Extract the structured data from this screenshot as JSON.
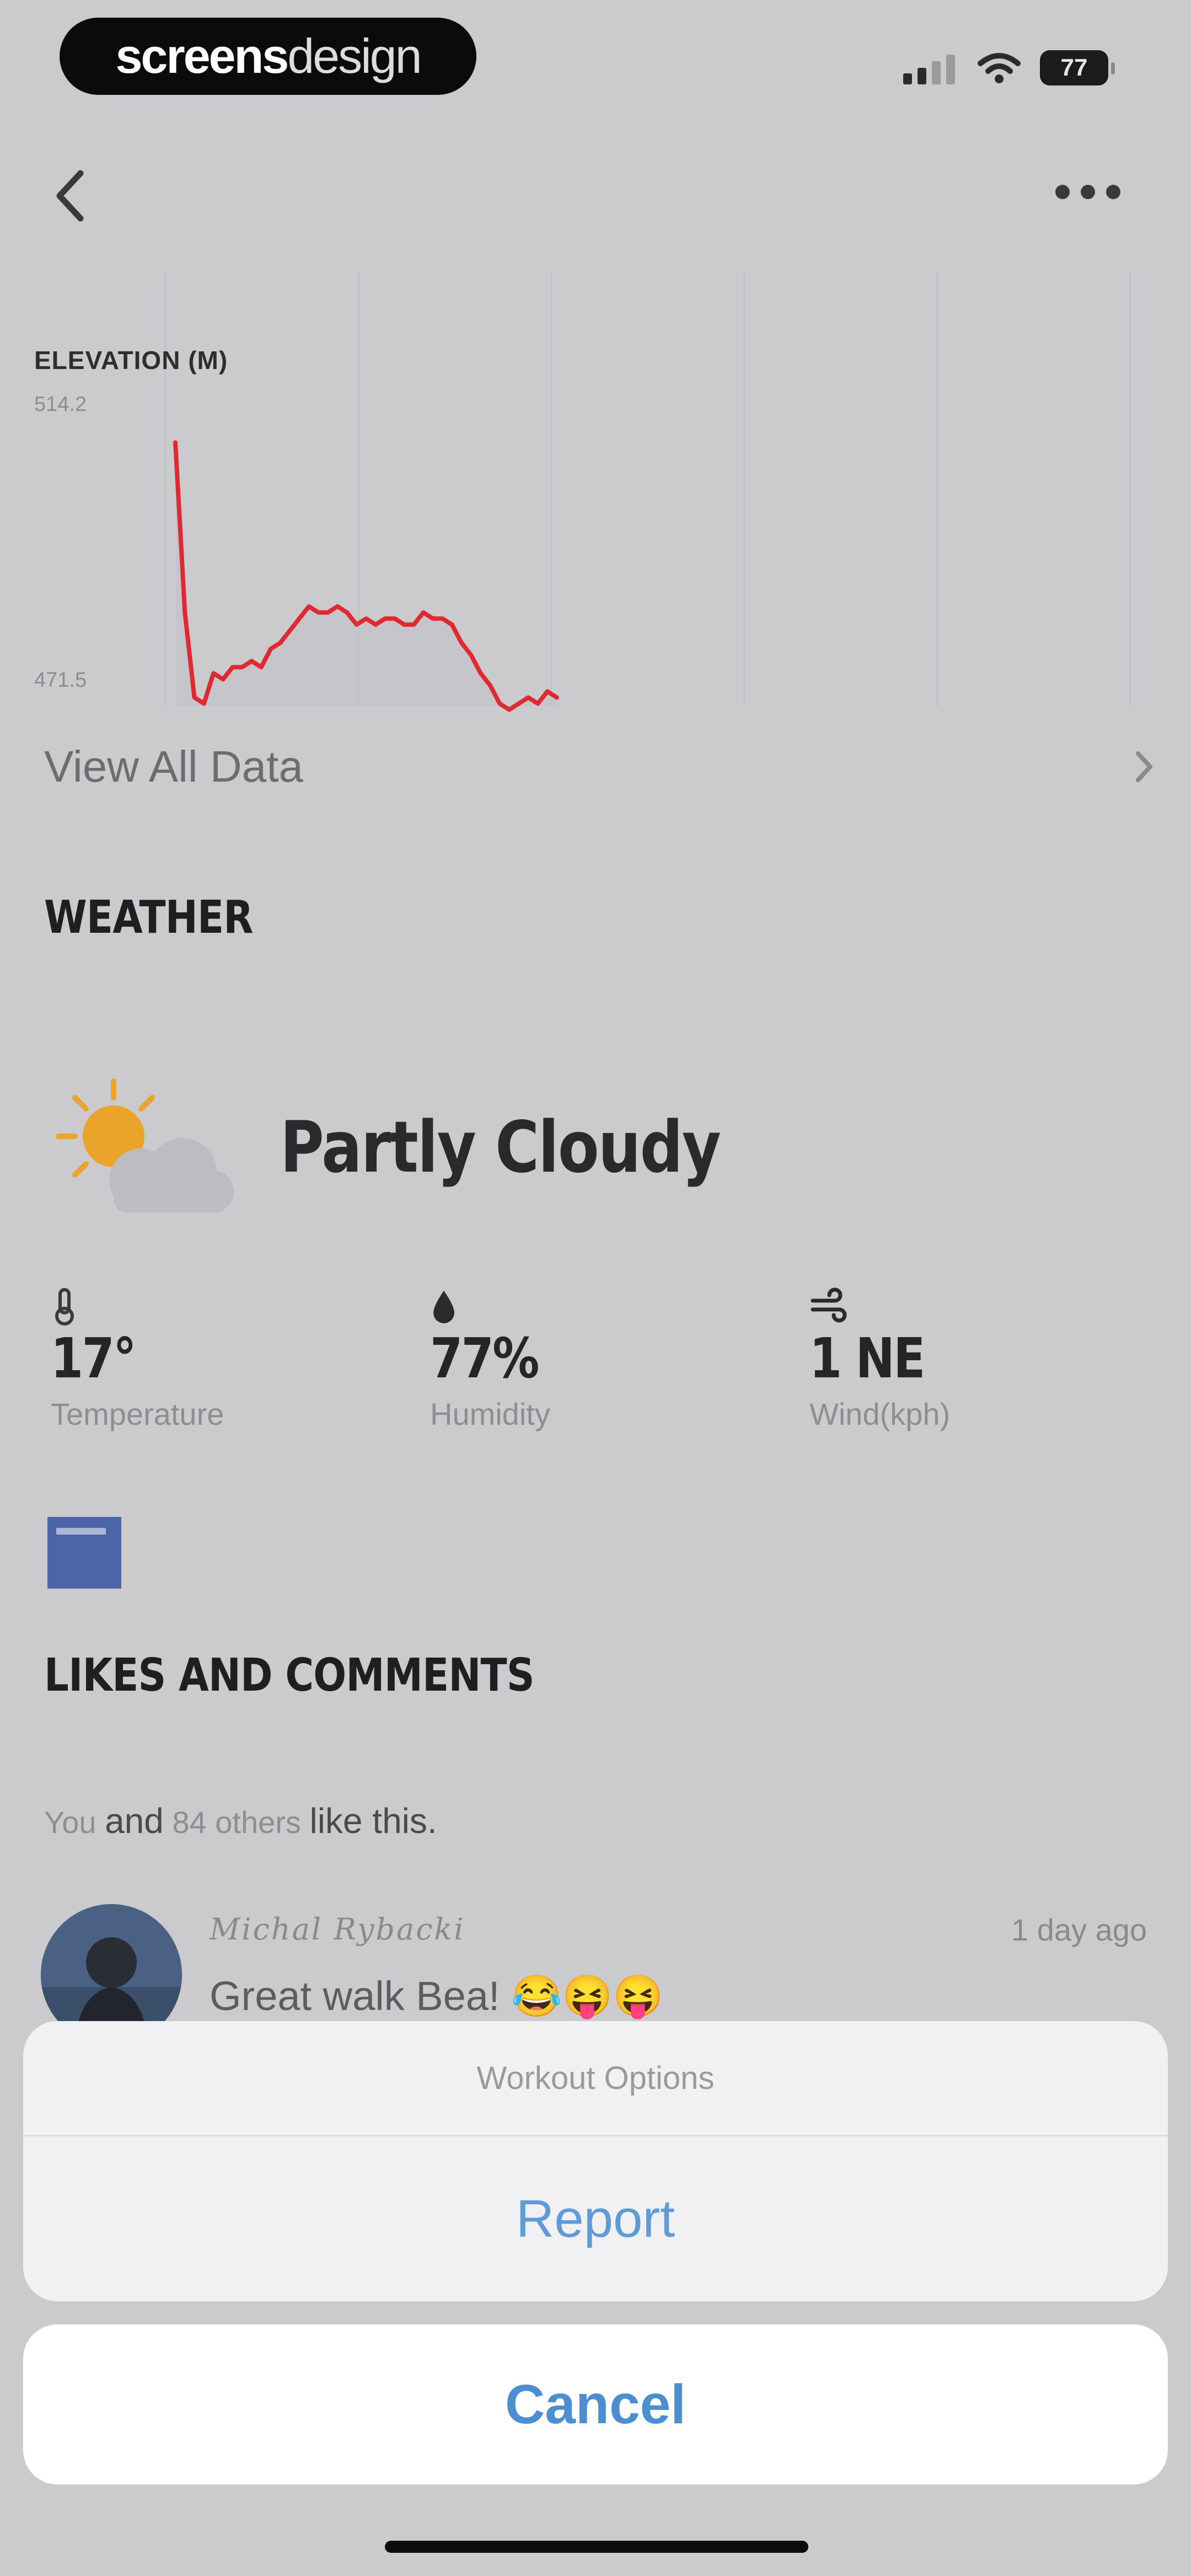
{
  "status_bar": {
    "brand_bold": "screens",
    "brand_light": "design",
    "battery": "77"
  },
  "chart_data": {
    "type": "line",
    "title": "ELEVATION (M)",
    "ylim": [
      471.5,
      514.2
    ],
    "ytick_labels": [
      "514.2",
      "471.5"
    ],
    "series": [
      {
        "color": "#e02a32",
        "x": [
          0,
          1,
          2,
          3,
          4,
          5,
          6,
          7,
          8,
          9,
          10,
          11,
          12,
          13,
          14,
          15,
          16,
          17,
          18,
          19,
          20,
          21,
          22,
          23,
          24,
          25,
          26,
          27,
          28,
          29,
          30,
          31,
          32,
          33,
          34,
          35,
          36,
          37,
          38,
          39,
          40
        ],
        "values": [
          514,
          486,
          472,
          471,
          476,
          475,
          477,
          477,
          478,
          477,
          480,
          481,
          483,
          485,
          487,
          486,
          486,
          487,
          486,
          484,
          485,
          484,
          485,
          485,
          484,
          484,
          486,
          485,
          485,
          484,
          481,
          479,
          476,
          474,
          471,
          470,
          471,
          472,
          471,
          473,
          472
        ]
      }
    ]
  },
  "view_all": "View All Data",
  "weather": {
    "section_title": "WEATHER",
    "condition": "Partly Cloudy",
    "stats": [
      {
        "value": "17°",
        "label": "Temperature"
      },
      {
        "value": "77%",
        "label": "Humidity"
      },
      {
        "value": "1 NE",
        "label": "Wind(kph)"
      }
    ]
  },
  "likes": {
    "section_title": "LIKES AND COMMENTS",
    "you": "You",
    "and": "and",
    "others": "84 others",
    "like_this": "like this."
  },
  "comment": {
    "author": "Michal Rybacki",
    "time": "1 day ago",
    "text": "Great walk Bea! 😂😝😝"
  },
  "sheet": {
    "title": "Workout Options",
    "report_label": "Report",
    "cancel_label": "Cancel"
  },
  "colors": {
    "accent_blue": "#4b8fd0",
    "chart_red": "#e02a32"
  }
}
